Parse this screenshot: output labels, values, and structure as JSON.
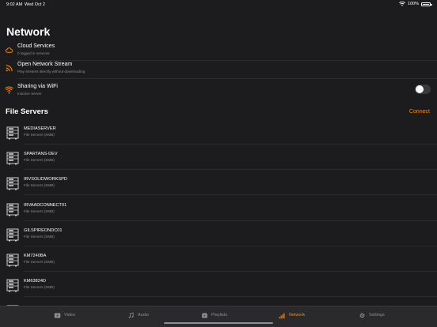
{
  "status_bar": {
    "time": "9:02 AM",
    "date": "Wed Oct 2",
    "battery": "100%"
  },
  "page": {
    "title": "Network"
  },
  "network_items": [
    {
      "title": "Cloud Services",
      "subtitle": "0 logged in services",
      "icon": "cloud-icon"
    },
    {
      "title": "Open Network Stream",
      "subtitle": "Play streams directly without downloading",
      "icon": "rss-icon"
    },
    {
      "title": "Sharing via WiFi",
      "subtitle": "Inactive Server",
      "icon": "wifi-icon",
      "toggle_on": false
    }
  ],
  "file_servers": {
    "title": "File Servers",
    "connect_label": "Connect",
    "items": [
      {
        "name": "MEDIASERVER",
        "type": "File Servers (SMB)"
      },
      {
        "name": "SPARTANS-DEV",
        "type": "File Servers (SMB)"
      },
      {
        "name": "IRVSOLIDWORKSPD",
        "type": "File Servers (SMB)"
      },
      {
        "name": "IRVAADCONNECT01",
        "type": "File Servers (SMB)"
      },
      {
        "name": "GILSPIREONDC01",
        "type": "File Servers (SMB)"
      },
      {
        "name": "KM7240BA",
        "type": "File Servers (SMB)"
      },
      {
        "name": "KM63824D",
        "type": "File Servers (SMB)"
      }
    ]
  },
  "tabs": [
    {
      "label": "Video",
      "icon": "video-icon",
      "active": false
    },
    {
      "label": "Audio",
      "icon": "music-note-icon",
      "active": false
    },
    {
      "label": "Playlists",
      "icon": "playlist-icon",
      "active": false
    },
    {
      "label": "Network",
      "icon": "network-bars-icon",
      "active": true
    },
    {
      "label": "Settings",
      "icon": "gear-icon",
      "active": false
    }
  ],
  "colors": {
    "accent": "#ff8800",
    "background": "#1c1c1e",
    "secondary_text": "#8e8e93",
    "tab_bar": "#2a2a2c"
  }
}
